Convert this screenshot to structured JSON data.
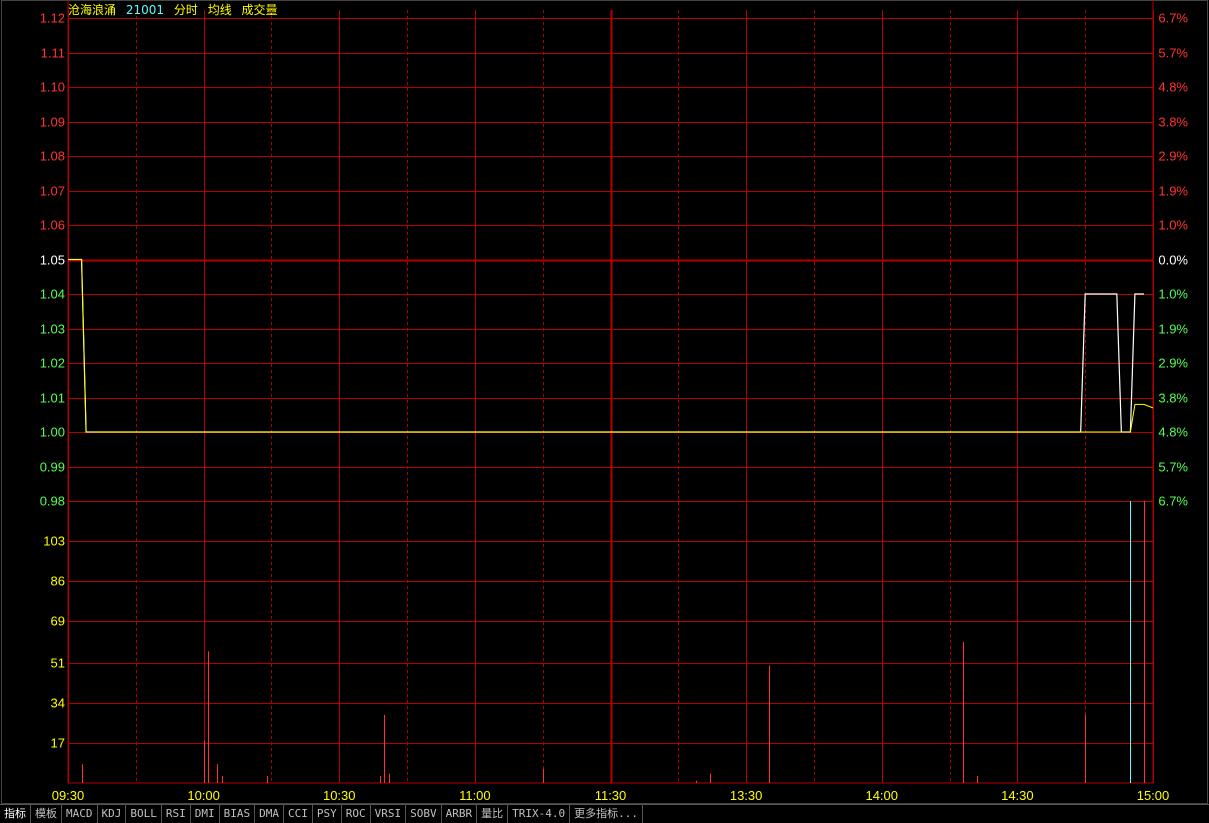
{
  "header": {
    "stock_name": "沧海浪涌",
    "code": "21001",
    "labels": [
      "分时",
      "均线",
      "成交量"
    ]
  },
  "colors": {
    "up": "#ff3232",
    "down": "#54ff54",
    "flat": "#ffffff",
    "grid": "#b40000",
    "volume_axis": "#ffff00",
    "name": "#ffff00",
    "code": "#54ffff",
    "price_line": "#ffffff",
    "avg_line": "#ffff00",
    "volume_bar": "#ff3232",
    "volume_bar_alt": "#54ffff"
  },
  "chart_data": {
    "type": "line",
    "prev_close": 1.05,
    "price_ticks": [
      "1.12",
      "1.11",
      "1.10",
      "1.09",
      "1.08",
      "1.07",
      "1.06",
      "1.05",
      "1.04",
      "1.03",
      "1.02",
      "1.01",
      "1.00",
      "0.99",
      "0.98"
    ],
    "pct_ticks": [
      "6.7%",
      "5.7%",
      "4.8%",
      "3.8%",
      "2.9%",
      "1.9%",
      "1.0%",
      "0.0%",
      "1.0%",
      "1.9%",
      "2.9%",
      "3.8%",
      "4.8%",
      "5.7%",
      "6.7%"
    ],
    "ylim": [
      0.98,
      1.12
    ],
    "volume_ticks": [
      "103",
      "86",
      "69",
      "51",
      "34",
      "17"
    ],
    "volume_ylim": [
      0,
      120
    ],
    "x_ticks": [
      "09:30",
      "10:00",
      "10:30",
      "11:00",
      "11:30",
      "13:30",
      "14:00",
      "14:30",
      "15:00"
    ],
    "total_minutes": 240,
    "price": [
      [
        0,
        1.05
      ],
      [
        3,
        1.05
      ],
      [
        4,
        1.0
      ],
      [
        224,
        1.0
      ],
      [
        225,
        1.04
      ],
      [
        232,
        1.04
      ],
      [
        233,
        1.0
      ],
      [
        235,
        1.0
      ],
      [
        236,
        1.04
      ],
      [
        238,
        1.04
      ]
    ],
    "avg": [
      [
        0,
        1.05
      ],
      [
        3,
        1.05
      ],
      [
        4,
        1.0
      ],
      [
        235,
        1.0
      ],
      [
        236,
        1.008
      ],
      [
        238,
        1.008
      ],
      [
        240,
        1.007
      ]
    ],
    "volume": [
      [
        3,
        8
      ],
      [
        30,
        18
      ],
      [
        31,
        56
      ],
      [
        33,
        8
      ],
      [
        34,
        3
      ],
      [
        44,
        3
      ],
      [
        69,
        3
      ],
      [
        70,
        29
      ],
      [
        71,
        4
      ],
      [
        105,
        6
      ],
      [
        139,
        1
      ],
      [
        142,
        4
      ],
      [
        155,
        50
      ],
      [
        198,
        60
      ],
      [
        201,
        3
      ],
      [
        225,
        29
      ],
      [
        235,
        120,
        "alt"
      ],
      [
        238,
        120
      ]
    ]
  },
  "toolbar": {
    "items": [
      "指标",
      "模板",
      "MACD",
      "KDJ",
      "BOLL",
      "RSI",
      "DMI",
      "BIAS",
      "DMA",
      "CCI",
      "PSY",
      "ROC",
      "VRSI",
      "SOBV",
      "ARBR",
      "量比",
      "TRIX-4.0",
      "更多指标..."
    ]
  }
}
